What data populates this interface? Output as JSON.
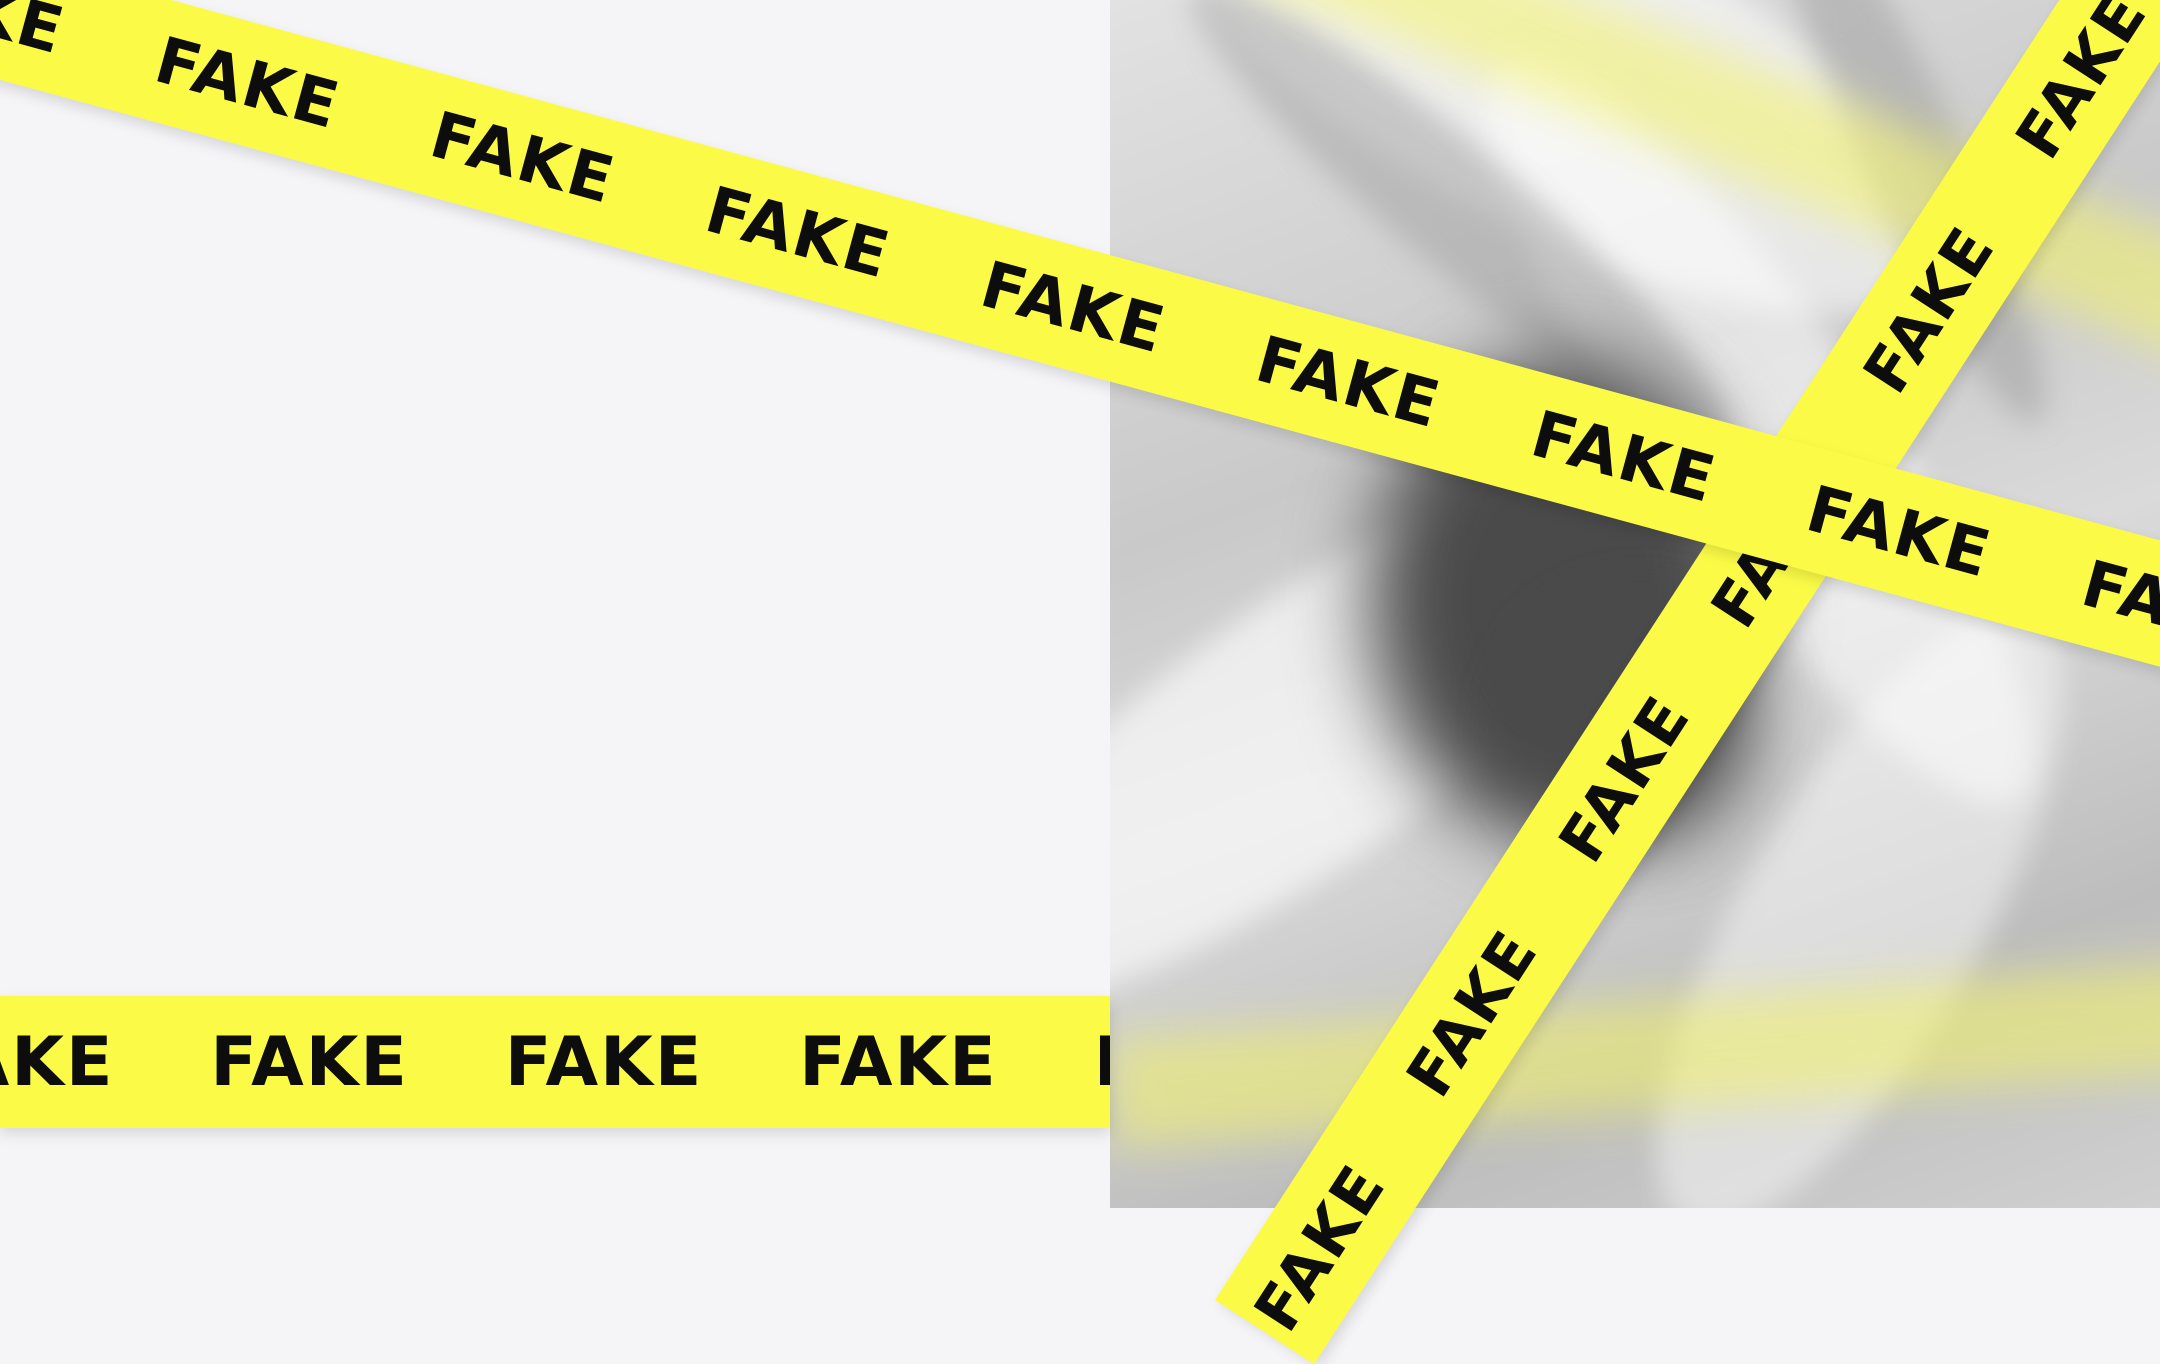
{
  "tape_text": "FAKE",
  "colors": {
    "tape": "#fbfb47",
    "text": "#0d0d0d",
    "left_background": "#f5f5f8",
    "fabric": "#cfcfcf"
  },
  "tapes": [
    {
      "name": "horizontal-tape",
      "label": "FAKE"
    },
    {
      "name": "diagonal-tape-down",
      "label": "FAKE"
    },
    {
      "name": "diagonal-tape-up",
      "label": "FAKE"
    }
  ]
}
